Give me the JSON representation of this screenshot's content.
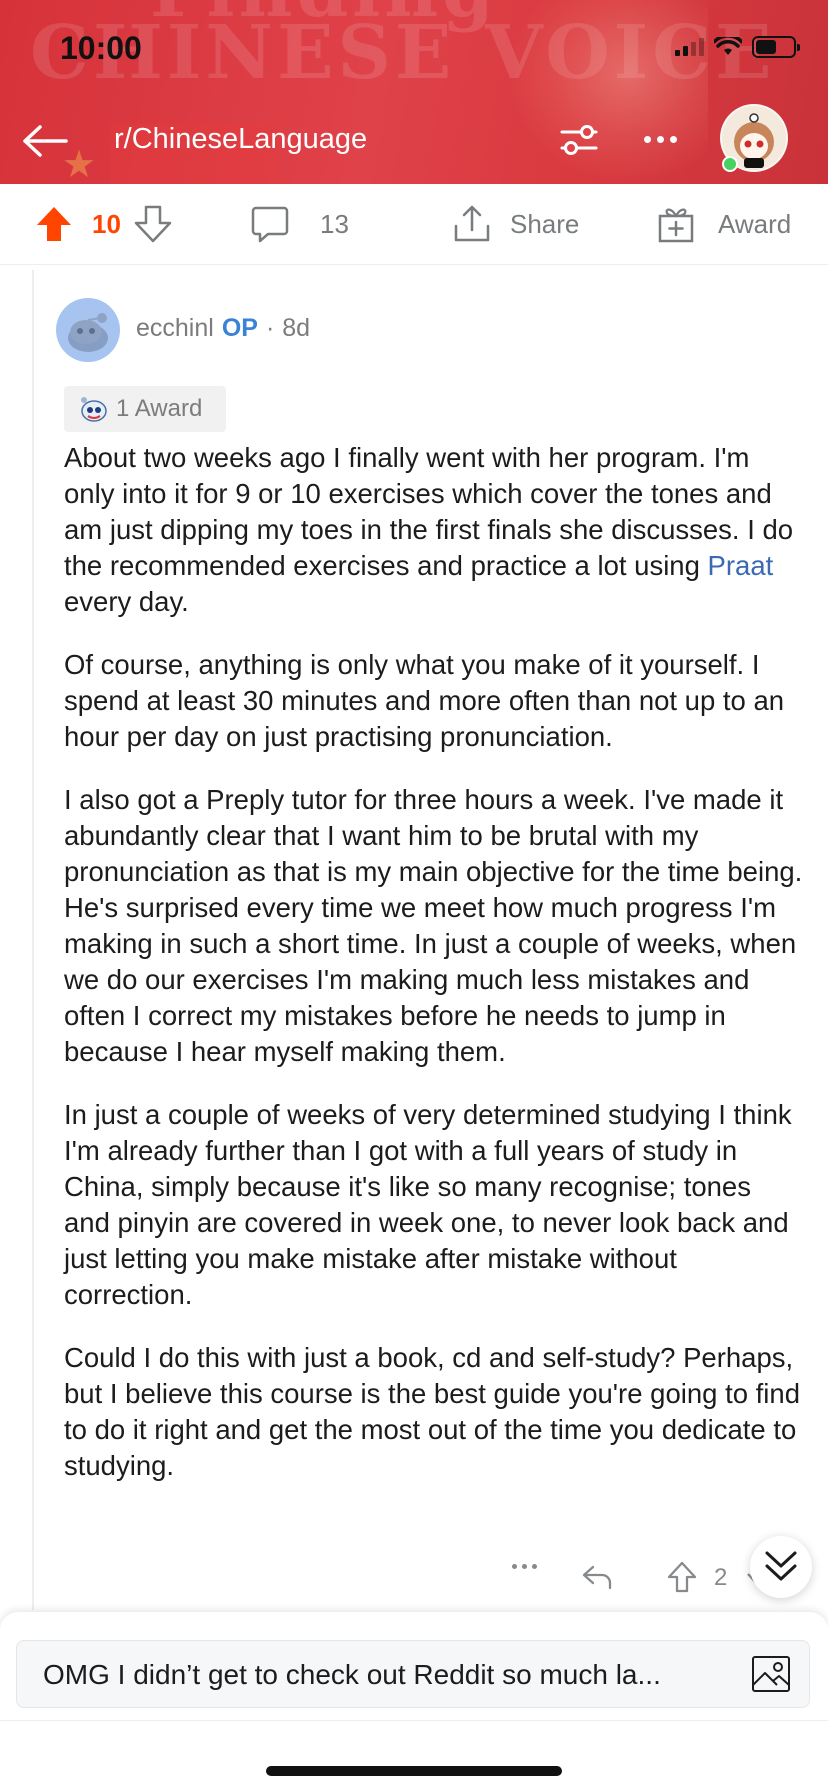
{
  "status_bar": {
    "time": "10:00"
  },
  "header": {
    "background_text": "CHINESE VOICE",
    "subreddit": "r/ChineseLanguage",
    "colors": {
      "background": "#d93a40",
      "foreground": "#ffffff"
    },
    "icons": {
      "back": "back-arrow-icon",
      "filter": "filter-icon",
      "more": "more-icon",
      "avatar": "user-avatar"
    }
  },
  "action_bar": {
    "upvote_count": "10",
    "comment_count": "13",
    "share_label": "Share",
    "award_label": "Award",
    "colors": {
      "upvote": "#ff4500",
      "muted": "#787c7e"
    }
  },
  "comment": {
    "author": "ecchinl",
    "op_badge": "OP",
    "separator": "·",
    "age": "8d",
    "award_label": "1 Award",
    "body": {
      "p1_before": "About two weeks ago I finally went with her program. I'm only into it for 9 or 10 exercises  which cover the tones and am just dipping my toes in the first finals she discusses. I do the recommended exercises and practice a lot using ",
      "p1_link": "Praat",
      "p1_after": " every day.",
      "p2": "Of course, anything is only what you make of it yourself. I spend at least 30 minutes and more often than not up to an hour per day on just practising pronunciation.",
      "p3": "I also got a Preply tutor for three hours a week. I've made it abundantly clear that I want him to be brutal with my pronunciation as that is my main objective for the time being. He's surprised every time we meet how much progress I'm making in such a short time. In just a couple of weeks, when we do our exercises I'm making much less mistakes and often I correct my mistakes before he needs to jump in because I hear myself making them.",
      "p4": "In just a couple of weeks of very determined studying I think I'm already further than I got with a full years of study in China, simply because it's like so many recognise; tones and pinyin are covered in week one, to never look back and just letting you make mistake after mistake without correction.",
      "p5": "Could I do this with just a book, cd and self-study? Perhaps, but I believe this course is the best guide you're going to find to do it right and get the most out of the time you dedicate to studying."
    },
    "score": "2",
    "colors": {
      "op": "#3a82d6",
      "link": "#3b6ab3"
    }
  },
  "compose": {
    "draft_text": "OMG I didn’t get to check out Reddit so much la..."
  }
}
